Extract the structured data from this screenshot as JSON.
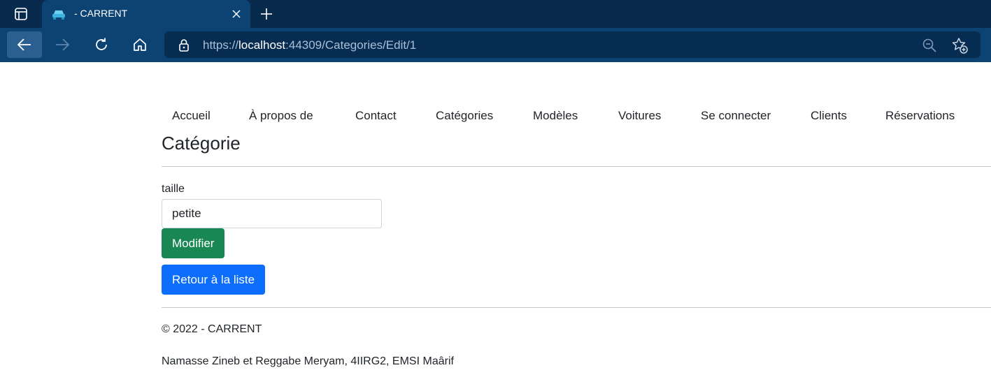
{
  "browser": {
    "tab_title": "- CARRENT",
    "url_scheme": "https://",
    "url_host": "localhost",
    "url_rest": ":44309/Categories/Edit/1",
    "icons": [
      "tab-actions-icon",
      "car-favicon-icon",
      "close-icon",
      "plus-icon",
      "back-arrow-icon",
      "forward-arrow-icon",
      "refresh-icon",
      "home-icon",
      "lock-icon",
      "zoom-out-icon",
      "add-favorite-icon"
    ]
  },
  "nav": {
    "items": [
      "Accueil",
      "À propos de",
      "Contact",
      "Catégories",
      "Modèles",
      "Voitures",
      "Se connecter",
      "Clients",
      "Réservations"
    ]
  },
  "main": {
    "title": "Catégorie",
    "field_label": "taille",
    "field_value": "petite",
    "modify_label": "Modifier",
    "back_label": "Retour à la liste"
  },
  "footer": {
    "copyright": "© 2022 - CARRENT",
    "authors": "Namasse Zineb et Reggabe Meryam, 4IIRG2, EMSI Maârif"
  },
  "colors": {
    "tabbar": "#082a4c",
    "toolbar": "#0c4373",
    "success": "#198754",
    "primary": "#0d6efd"
  }
}
